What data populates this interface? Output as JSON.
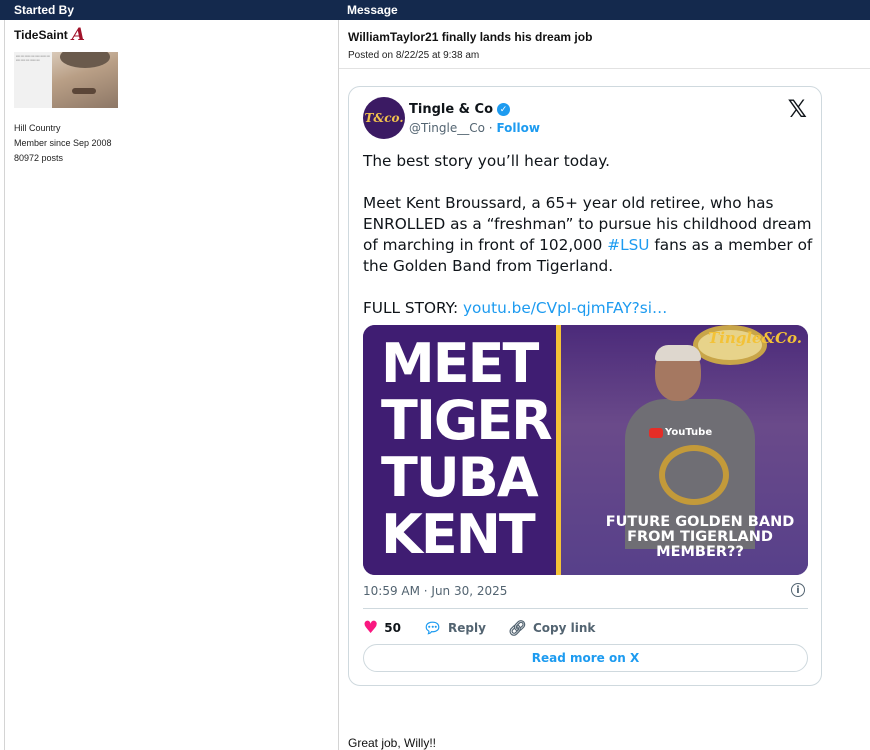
{
  "header": {
    "started_by": "Started By",
    "message": "Message"
  },
  "user": {
    "name": "TideSaint",
    "team_logo_glyph": "A",
    "location": "Hill Country",
    "member_since": "Member since Sep 2008",
    "posts": "80972 posts"
  },
  "post": {
    "title": "WilliamTaylor21 finally lands his dream job",
    "posted_on": "Posted on 8/22/25 at 9:38 am"
  },
  "tweet": {
    "avatar_text": "T&co.",
    "name": "Tingle & Co",
    "handle": "@Tingle__Co",
    "separator": "·",
    "follow": "Follow",
    "x_logo": "𝕏",
    "body_intro": "The best story you’ll hear today.",
    "body_main_1": "Meet Kent Broussard, a 65+ year old retiree, who has ENROLLED as a “freshman” to pursue his childhood dream of marching in front of 102,000 ",
    "hashtag": "#LSU",
    "body_main_2": " fans as a member of the Golden Band from Tigerland.",
    "story_label": "FULL STORY: ",
    "story_link": "youtu.be/CVpI-qjmFAY?si…",
    "media": {
      "headline": "MEET TIGER TUBA KENT",
      "caption": "FUTURE GOLDEN BAND FROM TIGERLAND MEMBER??",
      "logo": "Tingle&Co.",
      "youtube_label": "YouTube"
    },
    "date": "10:59 AM · Jun 30, 2025",
    "likes": "50",
    "reply": "Reply",
    "copy_link": "Copy link",
    "read_more": "Read more on X"
  },
  "reply_text": "Great job, Willy!!",
  "colors": {
    "header_bg": "#14294d",
    "accent": "#1d9bf0",
    "heart": "#f91880",
    "crimson": "#a1122a"
  }
}
